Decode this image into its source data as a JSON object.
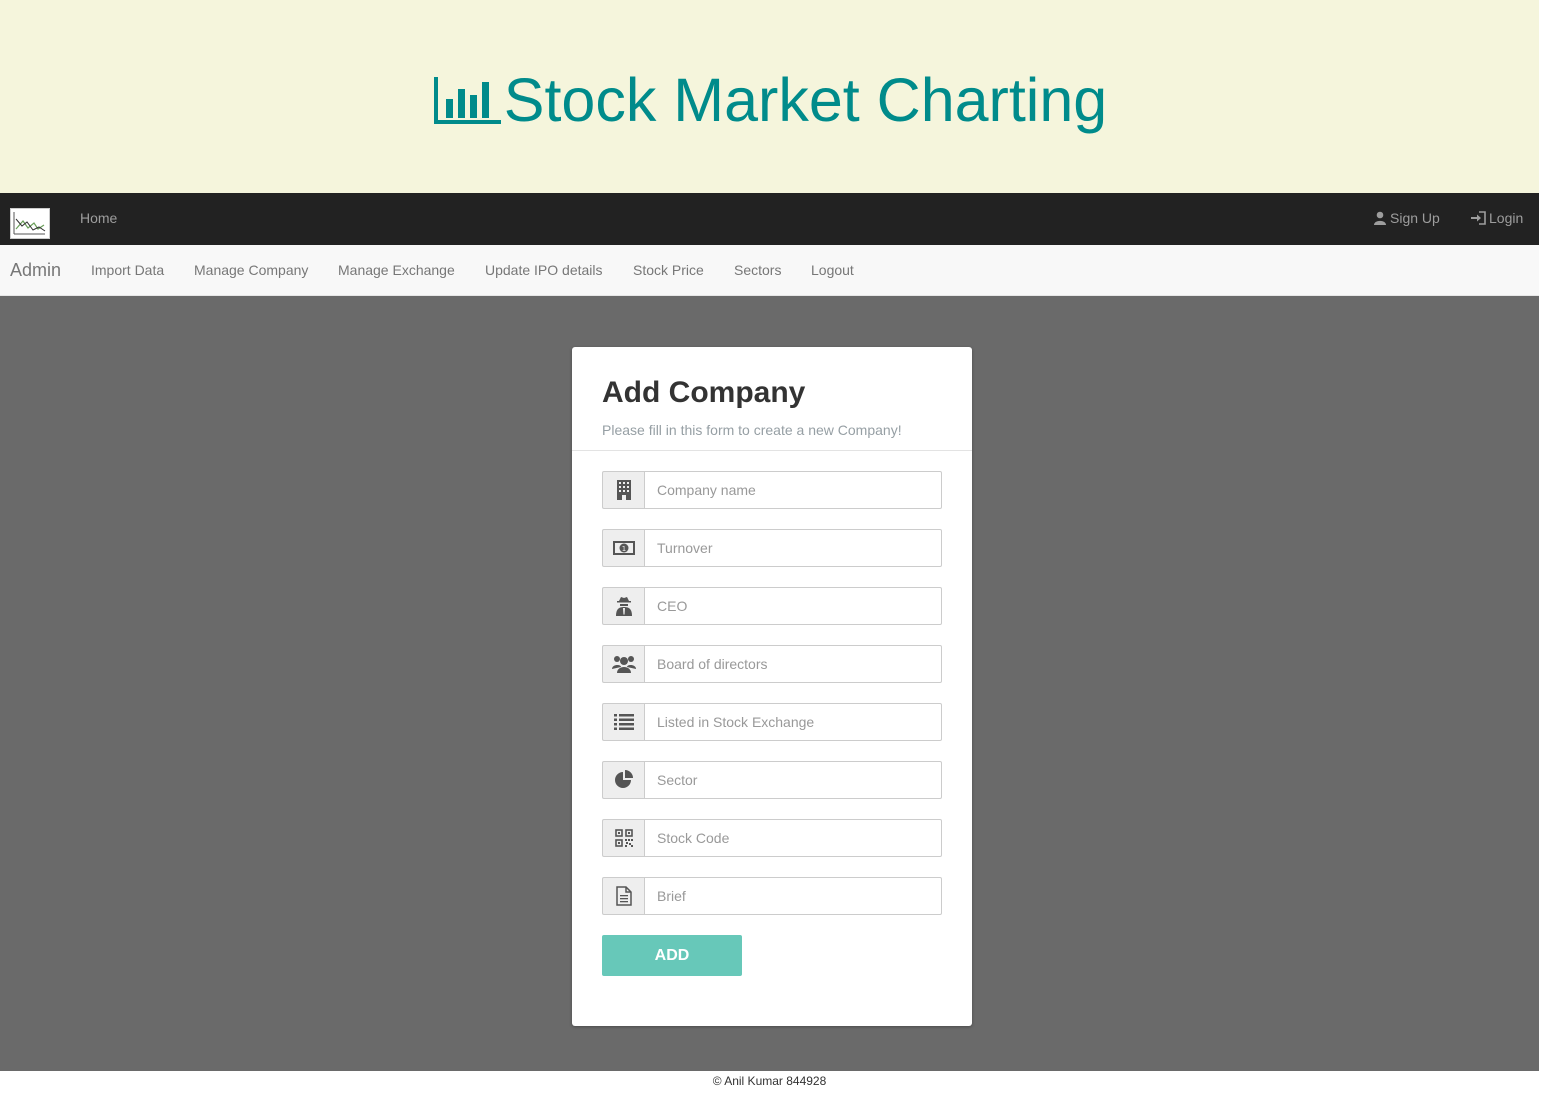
{
  "banner": {
    "title": "Stock Market Charting",
    "icon": "bar-chart-icon",
    "color": "#008b8b",
    "background": "#f5f5dc"
  },
  "topnav": {
    "home": "Home",
    "signup": "Sign Up",
    "login": "Login",
    "logo_icon": "stock-chart-logo",
    "background": "#222222"
  },
  "adminnav": {
    "brand": "Admin",
    "links": [
      "Import Data",
      "Manage Company",
      "Manage Exchange",
      "Update IPO details",
      "Stock Price",
      "Sectors",
      "Logout"
    ]
  },
  "form": {
    "title": "Add Company",
    "subtitle": "Please fill in this form to create a new Company!",
    "fields": [
      {
        "placeholder": "Company name",
        "icon": "building-icon"
      },
      {
        "placeholder": "Turnover",
        "icon": "money-icon"
      },
      {
        "placeholder": "CEO",
        "icon": "user-secret-icon"
      },
      {
        "placeholder": "Board of directors",
        "icon": "users-icon"
      },
      {
        "placeholder": "Listed in Stock Exchange",
        "icon": "list-icon"
      },
      {
        "placeholder": "Sector",
        "icon": "pie-chart-icon"
      },
      {
        "placeholder": "Stock Code",
        "icon": "qrcode-icon"
      },
      {
        "placeholder": "Brief",
        "icon": "file-text-icon"
      }
    ],
    "submit": "ADD",
    "button_color": "#67c8b9"
  },
  "footer": {
    "text": "© Anil Kumar 844928"
  }
}
